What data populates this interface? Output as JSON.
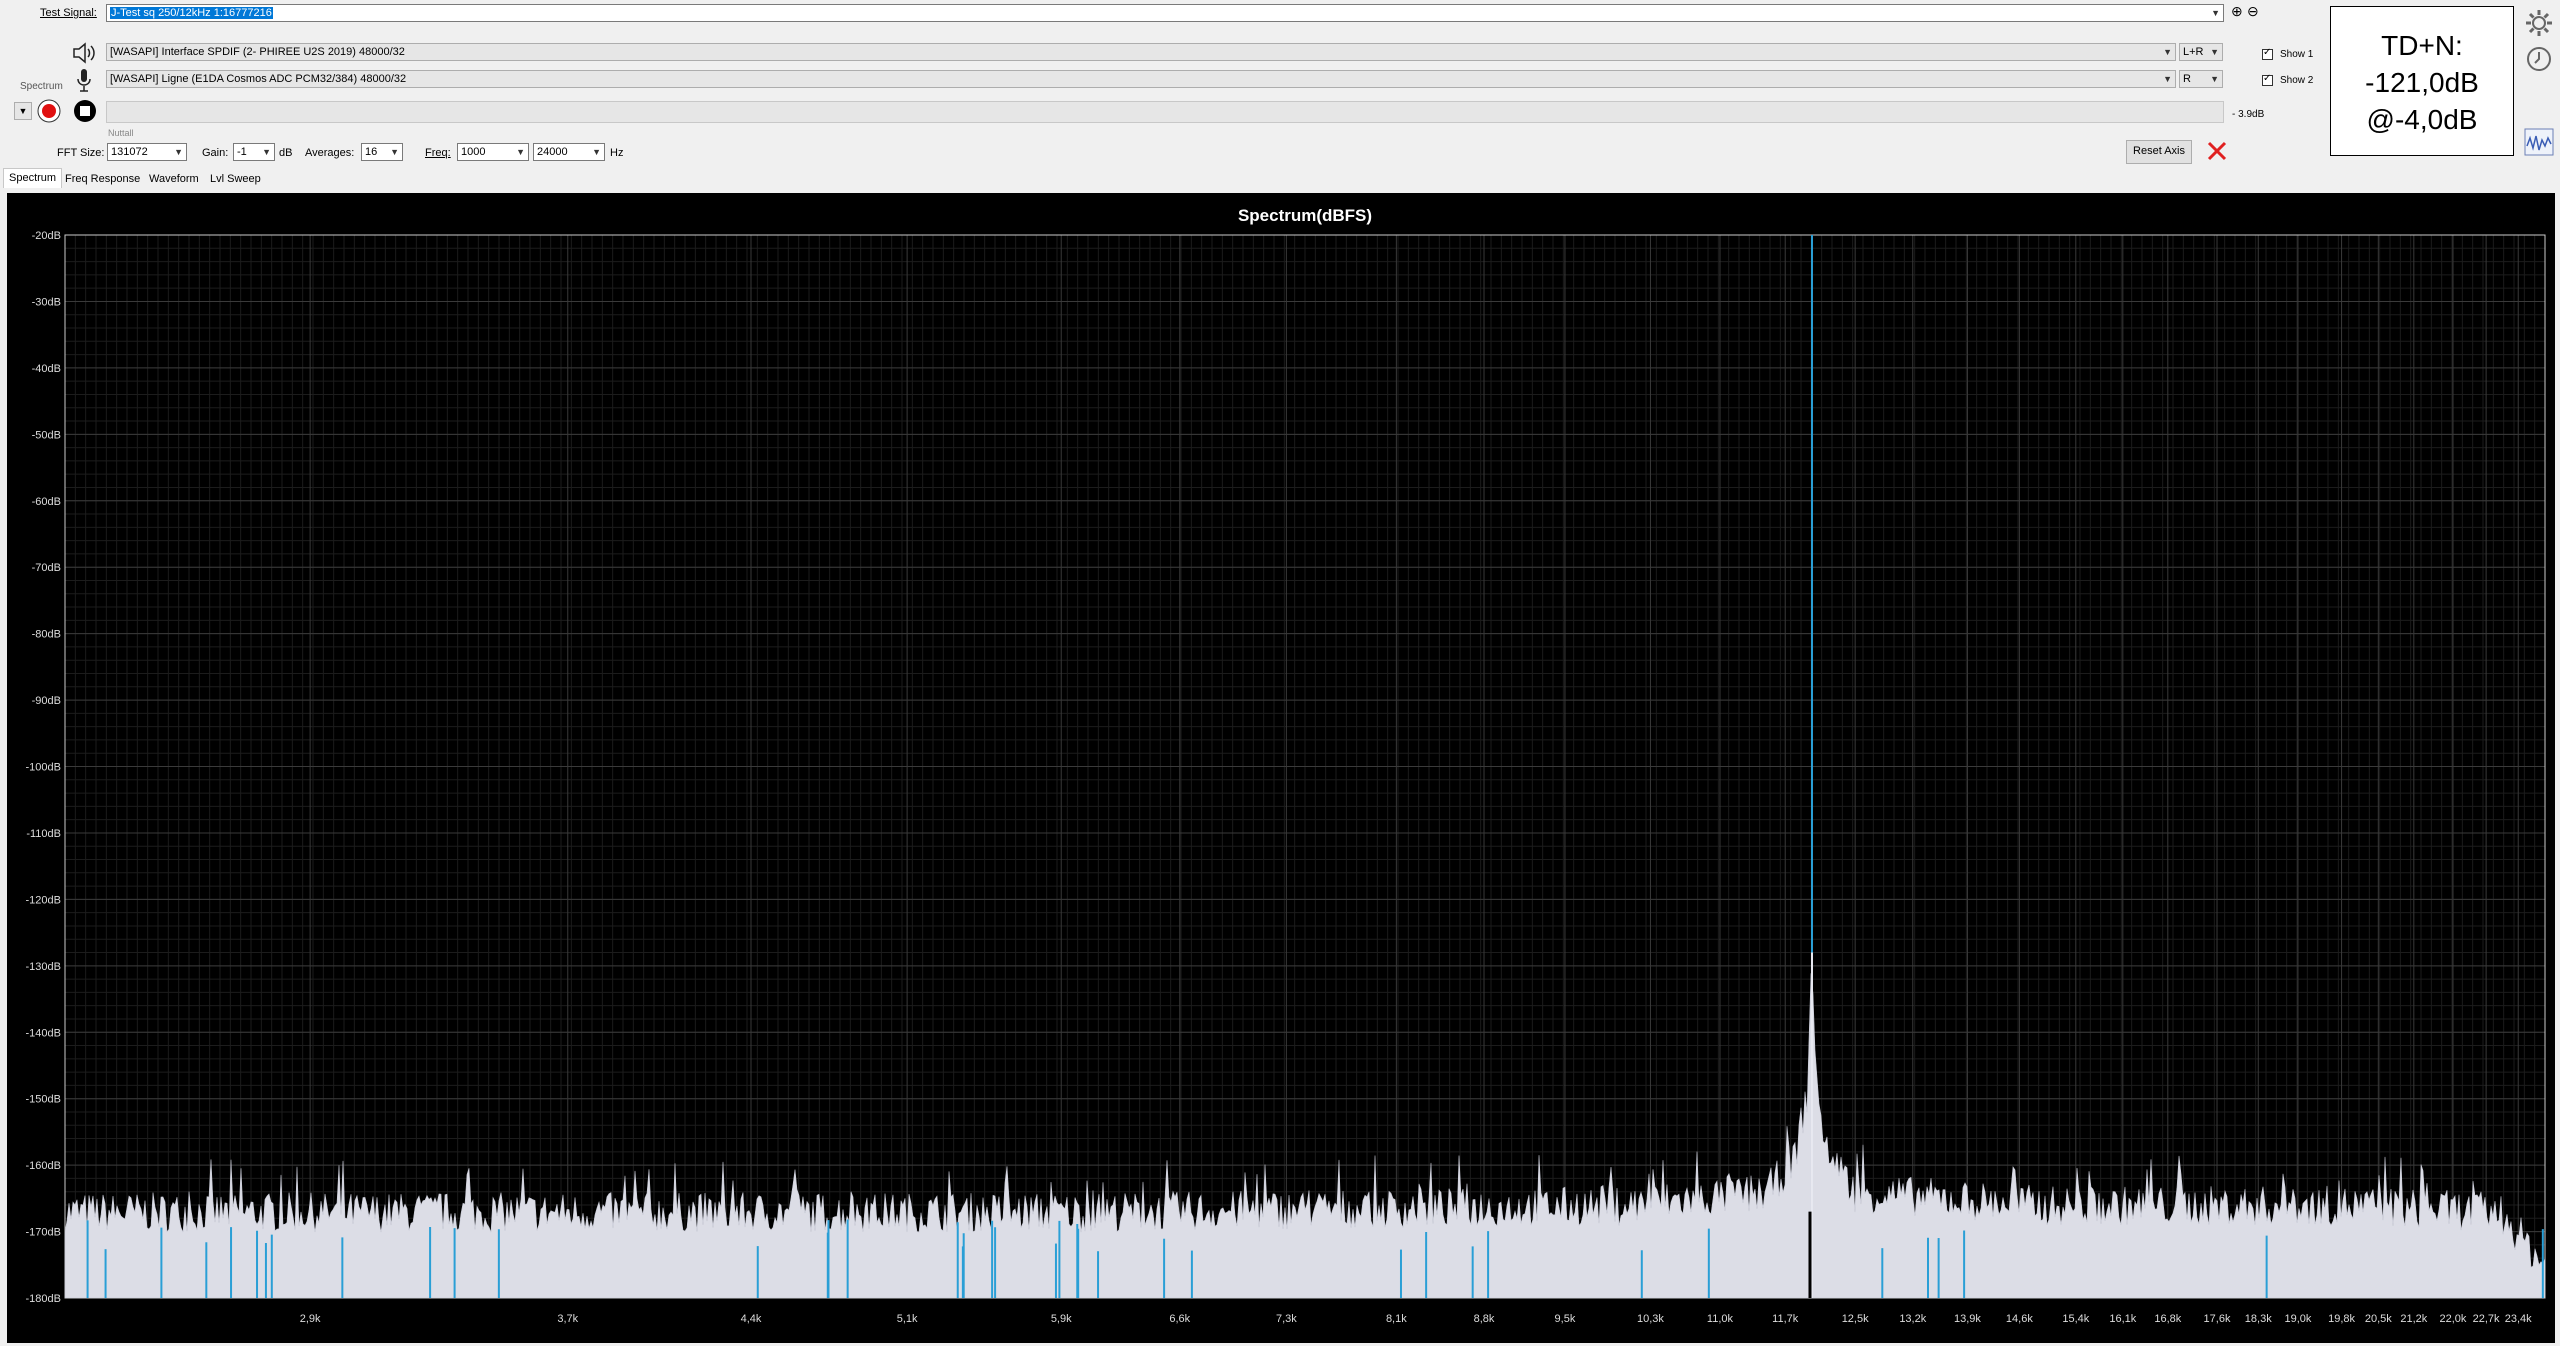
{
  "toolbar": {
    "test_signal_label": "Test Signal:",
    "test_signal_value": "J-Test sq 250/12kHz 1:16777216",
    "output_device": "[WASAPI] Interface SPDIF (2- PHIREE U2S 2019) 48000/32",
    "output_channel": "L+R",
    "input_device": "[WASAPI] Ligne (E1DA Cosmos ADC PCM32/384) 48000/32",
    "input_channel": "R",
    "mode_label": "Spectrum",
    "window_label": "Nuttall",
    "level_readout": "- 3.9dB",
    "show1_label": "Show 1",
    "show2_label": "Show 2"
  },
  "params": {
    "fft_size_label": "FFT Size:",
    "fft_size": "131072",
    "gain_label": "Gain:",
    "gain": "-1",
    "gain_unit": "dB",
    "averages_label": "Averages:",
    "averages": "16",
    "freq_label": "Freq:",
    "freq_start": "1000",
    "freq_end": "24000",
    "freq_unit": "Hz",
    "reset_axis_label": "Reset Axis"
  },
  "tdn": {
    "line1": "TD+N:",
    "line2": "-121,0dB",
    "line3": "@-4,0dB"
  },
  "tabs": [
    "Spectrum",
    "Freq Response",
    "Waveform",
    "Lvl Sweep"
  ],
  "icons": {
    "settings": "gear-icon",
    "clock": "clock-icon",
    "speaker": "speaker-icon",
    "mic": "microphone-icon",
    "record": "record-icon",
    "stop": "stop-icon",
    "close": "close-icon",
    "zoom_in": "plus-circle-icon",
    "zoom_out": "minus-circle-icon",
    "wave_thumb": "waveform-icon"
  },
  "colors": {
    "accent": "#0078d7",
    "plot_bg": "#000000",
    "noise_fill": "#dcdde6",
    "tone_line": "#2a9fd6",
    "close_x": "#e02020"
  },
  "chart_data": {
    "type": "area",
    "title": "Spectrum(dBFS)",
    "xlabel": "",
    "ylabel": "",
    "y_ticks": [
      "-20dB",
      "-30dB",
      "-40dB",
      "-50dB",
      "-60dB",
      "-70dB",
      "-80dB",
      "-90dB",
      "-100dB",
      "-110dB",
      "-120dB",
      "-130dB",
      "-140dB",
      "-150dB",
      "-160dB",
      "-170dB",
      "-180dB"
    ],
    "ylim": [
      -180,
      -20
    ],
    "x_scale": "log",
    "xlim": [
      1000,
      24000
    ],
    "x_ticks": [
      {
        "label": "2,9k",
        "value": 2900
      },
      {
        "label": "3,7k",
        "value": 3700
      },
      {
        "label": "4,4k",
        "value": 4400
      },
      {
        "label": "5,1k",
        "value": 5100
      },
      {
        "label": "5,9k",
        "value": 5900
      },
      {
        "label": "6,6k",
        "value": 6600
      },
      {
        "label": "7,3k",
        "value": 7300
      },
      {
        "label": "8,1k",
        "value": 8100
      },
      {
        "label": "8,8k",
        "value": 8800
      },
      {
        "label": "9,5k",
        "value": 9500
      },
      {
        "label": "10,3k",
        "value": 10300
      },
      {
        "label": "11,0k",
        "value": 11000
      },
      {
        "label": "11,7k",
        "value": 11700
      },
      {
        "label": "12,5k",
        "value": 12500
      },
      {
        "label": "13,2k",
        "value": 13200
      },
      {
        "label": "13,9k",
        "value": 13900
      },
      {
        "label": "14,6k",
        "value": 14600
      },
      {
        "label": "15,4k",
        "value": 15400
      },
      {
        "label": "16,1k",
        "value": 16100
      },
      {
        "label": "16,8k",
        "value": 16800
      },
      {
        "label": "17,6k",
        "value": 17600
      },
      {
        "label": "18,3k",
        "value": 18300
      },
      {
        "label": "19,0k",
        "value": 19000
      },
      {
        "label": "19,8k",
        "value": 19800
      },
      {
        "label": "20,5k",
        "value": 20500
      },
      {
        "label": "21,2k",
        "value": 21200
      },
      {
        "label": "22,0k",
        "value": 22000
      },
      {
        "label": "22,7k",
        "value": 22700
      },
      {
        "label": "23,4k",
        "value": 23400
      }
    ],
    "grid": true,
    "series": [
      {
        "name": "",
        "kind": "tone",
        "x": 12000,
        "y": -20
      },
      {
        "name": "",
        "kind": "noise_floor",
        "x": [
          1000,
          6000,
          10000,
          11500,
          11800,
          11950,
          12000,
          12050,
          12200,
          12500,
          15000,
          20000,
          23000,
          24000
        ],
        "y": [
          -168,
          -168,
          -167,
          -165,
          -160,
          -150,
          -128,
          -150,
          -160,
          -165,
          -167,
          -167,
          -168,
          -176
        ]
      }
    ]
  }
}
